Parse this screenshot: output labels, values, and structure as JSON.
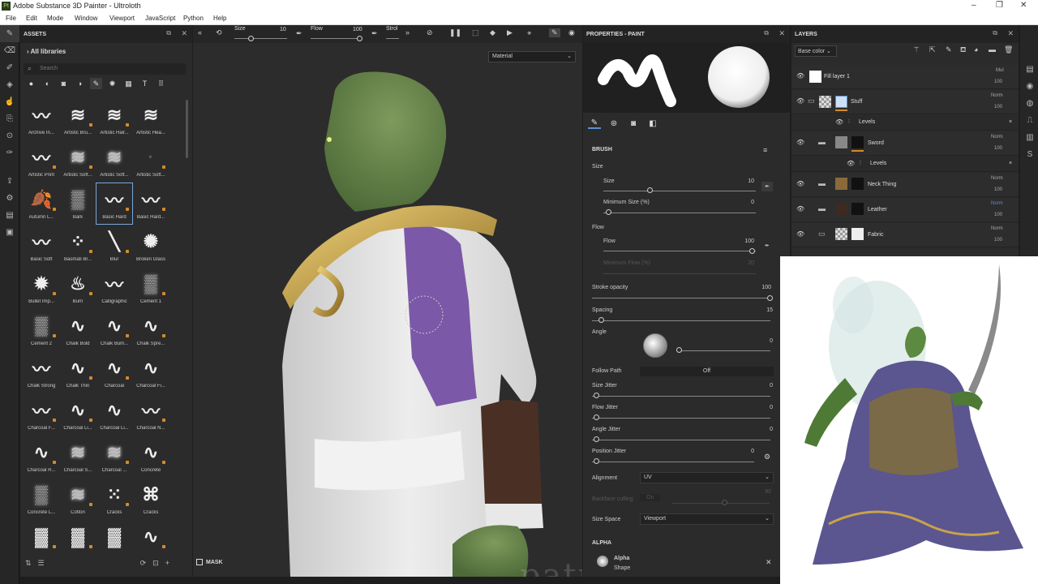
{
  "window": {
    "title": "Adobe Substance 3D Painter - Ultroloth",
    "app_icon": "Pt",
    "controls": [
      "–",
      "❐",
      "✕"
    ]
  },
  "menu": [
    "File",
    "Edit",
    "Mode",
    "Window",
    "Viewport",
    "JavaScript",
    "Python",
    "Help"
  ],
  "toolstrip": {
    "icons": [
      "paint-brush-icon",
      "eraser-icon",
      "projection-icon",
      "geometry-mask-icon",
      "smudge-icon",
      "clone-icon",
      "material-picker-icon",
      "color-picker-icon",
      "export-icon",
      "bake-icon",
      "render-icon",
      "layers-icon"
    ]
  },
  "assets": {
    "title": "ASSETS",
    "library": "All libraries",
    "search_placeholder": "Search",
    "filter_icons": [
      "sphere-icon",
      "texture-icon",
      "smart-mask-icon",
      "alpha-icon",
      "brush-icon",
      "particles-icon",
      "environment-icon",
      "text-icon",
      "grid-view-icon"
    ],
    "brushes": [
      {
        "label": "Archive In...",
        "glyph": "〰"
      },
      {
        "label": "Artistic Bru...",
        "glyph": "≋"
      },
      {
        "label": "Artistic Hair...",
        "glyph": "≋"
      },
      {
        "label": "Artistic Hea...",
        "glyph": "≋"
      },
      {
        "label": "Artistic Print",
        "glyph": "〰"
      },
      {
        "label": "Artistic Soft...",
        "glyph": "≋"
      },
      {
        "label": "Artistic Soft...",
        "glyph": "≋"
      },
      {
        "label": "Artistic Soft...",
        "glyph": "·"
      },
      {
        "label": "Autumn L...",
        "glyph": "🍂"
      },
      {
        "label": "Bark",
        "glyph": "▒"
      },
      {
        "label": "Basic Hard",
        "glyph": "〰"
      },
      {
        "label": "Basic Hard...",
        "glyph": "〰"
      },
      {
        "label": "Basic Soft",
        "glyph": "〰"
      },
      {
        "label": "Basmati Br...",
        "glyph": "⁘"
      },
      {
        "label": "Blur",
        "glyph": "╲"
      },
      {
        "label": "Broken Glass",
        "glyph": "✺"
      },
      {
        "label": "Bullet Imp...",
        "glyph": "✹"
      },
      {
        "label": "Burn",
        "glyph": "♨"
      },
      {
        "label": "Calligraphic",
        "glyph": "〰"
      },
      {
        "label": "Cement 1",
        "glyph": "▒"
      },
      {
        "label": "Cement 2",
        "glyph": "▒"
      },
      {
        "label": "Chalk Bold",
        "glyph": "∿"
      },
      {
        "label": "Chalk Bum...",
        "glyph": "∿"
      },
      {
        "label": "Chalk Spre...",
        "glyph": "∿"
      },
      {
        "label": "Chalk Strong",
        "glyph": "〰"
      },
      {
        "label": "Chalk Thin",
        "glyph": "∿"
      },
      {
        "label": "Charcoal",
        "glyph": "∿"
      },
      {
        "label": "Charcoal Fi...",
        "glyph": "∿"
      },
      {
        "label": "Charcoal F...",
        "glyph": "〰"
      },
      {
        "label": "Charcoal Li...",
        "glyph": "∿"
      },
      {
        "label": "Charcoal Li...",
        "glyph": "∿"
      },
      {
        "label": "Charcoal N...",
        "glyph": "〰"
      },
      {
        "label": "Charcoal R...",
        "glyph": "∿"
      },
      {
        "label": "Charcoal S...",
        "glyph": "≋"
      },
      {
        "label": "Charcoal ...",
        "glyph": "≋"
      },
      {
        "label": "Concrete",
        "glyph": "∿"
      },
      {
        "label": "Concrete L...",
        "glyph": "▒"
      },
      {
        "label": "Cotton",
        "glyph": "≋"
      },
      {
        "label": "Cracks",
        "glyph": "⁙"
      },
      {
        "label": "Cracks",
        "glyph": "⌘"
      },
      {
        "label": "",
        "glyph": "▓"
      },
      {
        "label": "",
        "glyph": "▓"
      },
      {
        "label": "",
        "glyph": "▓"
      },
      {
        "label": "",
        "glyph": "∿"
      }
    ]
  },
  "viewport": {
    "size_label": "Size",
    "size_value": "10",
    "flow_label": "Flow",
    "flow_value": "100",
    "stroke_label": "Strol",
    "material_mode": "Material",
    "mask_label": "MASK",
    "watermark": "patreon.com/Lodaim"
  },
  "properties": {
    "title": "PROPERTIES - PAINT",
    "section": "BRUSH",
    "size_group": "Size",
    "size_label": "Size",
    "size_value": "10",
    "min_size_label": "Minimum Size (%)",
    "min_size_value": "0",
    "flow_group": "Flow",
    "flow_label": "Flow",
    "flow_value": "100",
    "min_flow_label": "Minimum Flow (%)",
    "min_flow_value": "20",
    "stroke_opacity_label": "Stroke opacity",
    "stroke_opacity_value": "100",
    "spacing_label": "Spacing",
    "spacing_value": "15",
    "angle_label": "Angle",
    "angle_value": "0",
    "follow_path_label": "Follow Path",
    "follow_path_value": "Off",
    "size_jitter_label": "Size Jitter",
    "size_jitter_value": "0",
    "flow_jitter_label": "Flow Jitter",
    "flow_jitter_value": "0",
    "angle_jitter_label": "Angle Jitter",
    "angle_jitter_value": "0",
    "position_jitter_label": "Position Jitter",
    "position_jitter_value": "0",
    "alignment_label": "Alignment",
    "alignment_value": "UV",
    "backface_label": "Backface culling",
    "backface_value": "On",
    "backface_num": "90",
    "size_space_label": "Size Space",
    "size_space_value": "Viewport",
    "alpha_section": "ALPHA",
    "alpha_name": "Alpha",
    "alpha_sub": "Shape"
  },
  "layers": {
    "title": "LAYERS",
    "channel": "Base color",
    "items": [
      {
        "name": "Fill layer 1",
        "blend": "Mul",
        "opacity": "100"
      },
      {
        "name": "Stuff",
        "blend": "Norm",
        "opacity": "100"
      },
      {
        "name": "Levels",
        "blend": "",
        "opacity": ""
      },
      {
        "name": "Sword",
        "blend": "Norm",
        "opacity": "100"
      },
      {
        "name": "Levels",
        "blend": "",
        "opacity": ""
      },
      {
        "name": "Neck Thing",
        "blend": "Norm",
        "opacity": "100"
      },
      {
        "name": "Leather",
        "blend": "Norm",
        "opacity": "100"
      },
      {
        "name": "Fabric",
        "blend": "Norm",
        "opacity": "100"
      }
    ]
  },
  "colors": {
    "accent": "#5b8fd0",
    "panel": "#2b2b2b",
    "header": "#232323",
    "viewport": "#2c2c2c",
    "orange_mark": "#d68a2a"
  }
}
